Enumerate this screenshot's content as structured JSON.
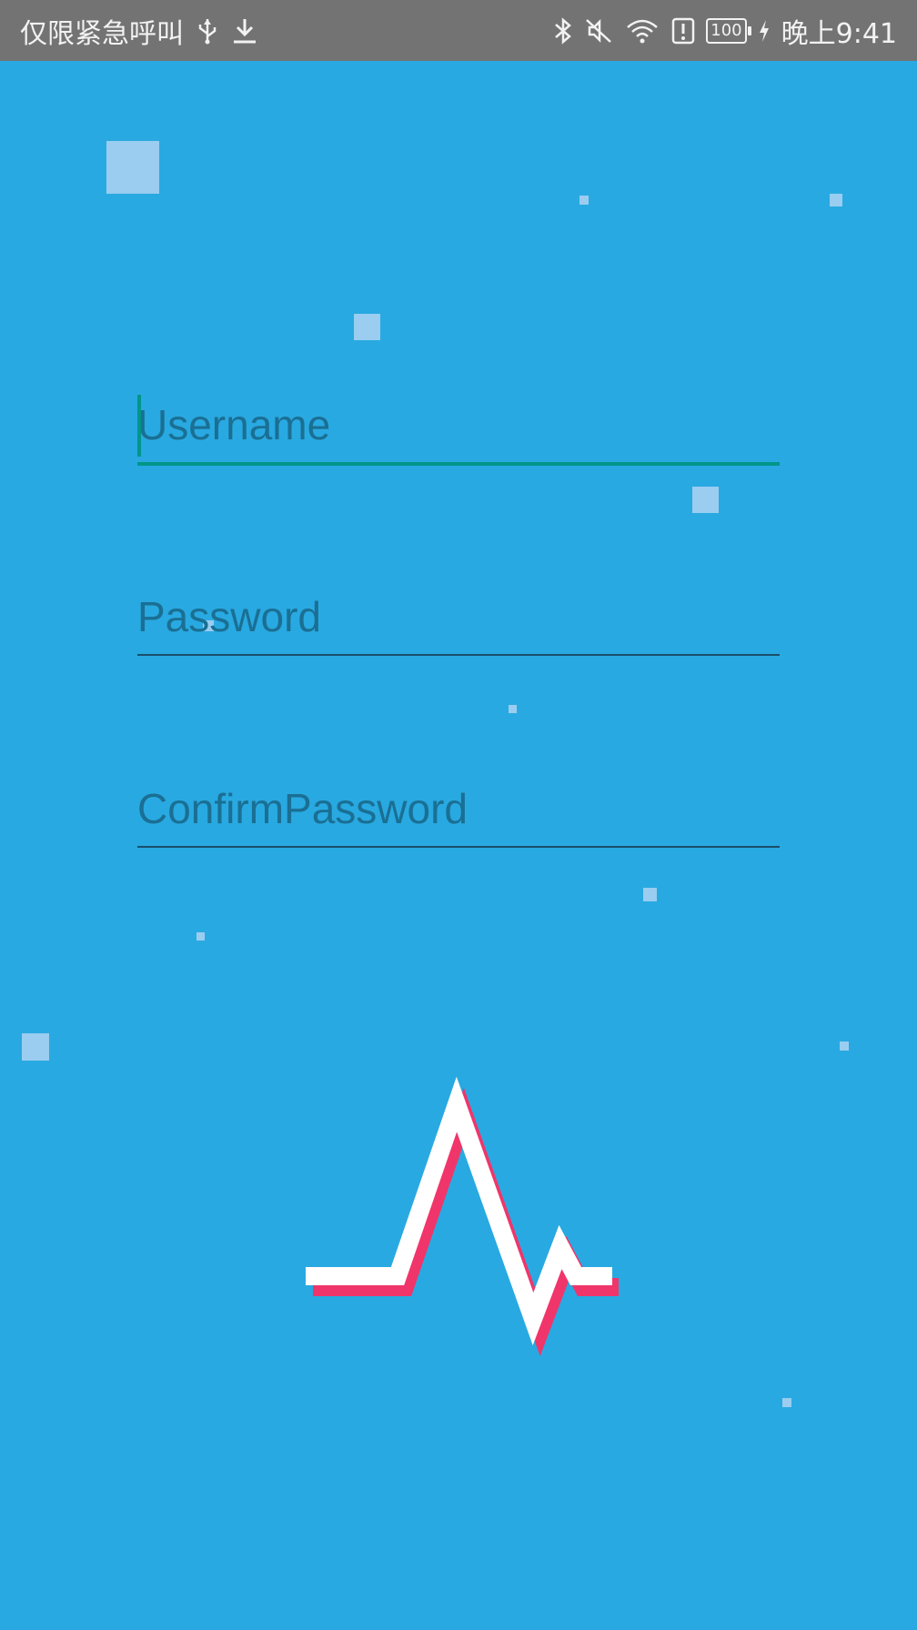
{
  "status_bar": {
    "carrier_text": "仅限紧急呼叫",
    "battery_level": "100",
    "time": "晚上9:41",
    "icons": [
      "usb-icon",
      "download-icon",
      "bluetooth-icon",
      "mute-icon",
      "wifi-icon",
      "alert-icon",
      "battery-icon",
      "charging-icon"
    ]
  },
  "form": {
    "username_placeholder": "Username",
    "password_placeholder": "Password",
    "confirm_password_placeholder": "ConfirmPassword"
  },
  "colors": {
    "background": "#29A9E1",
    "status_bar": "#737373",
    "accent": "#009688",
    "hint_text": "#1A6F93",
    "logo_white": "#FFFFFF",
    "logo_shadow": "#F0356B",
    "decor_square": "#9ACDF0"
  },
  "logo": {
    "icon": "heartbeat-pulse-icon"
  }
}
